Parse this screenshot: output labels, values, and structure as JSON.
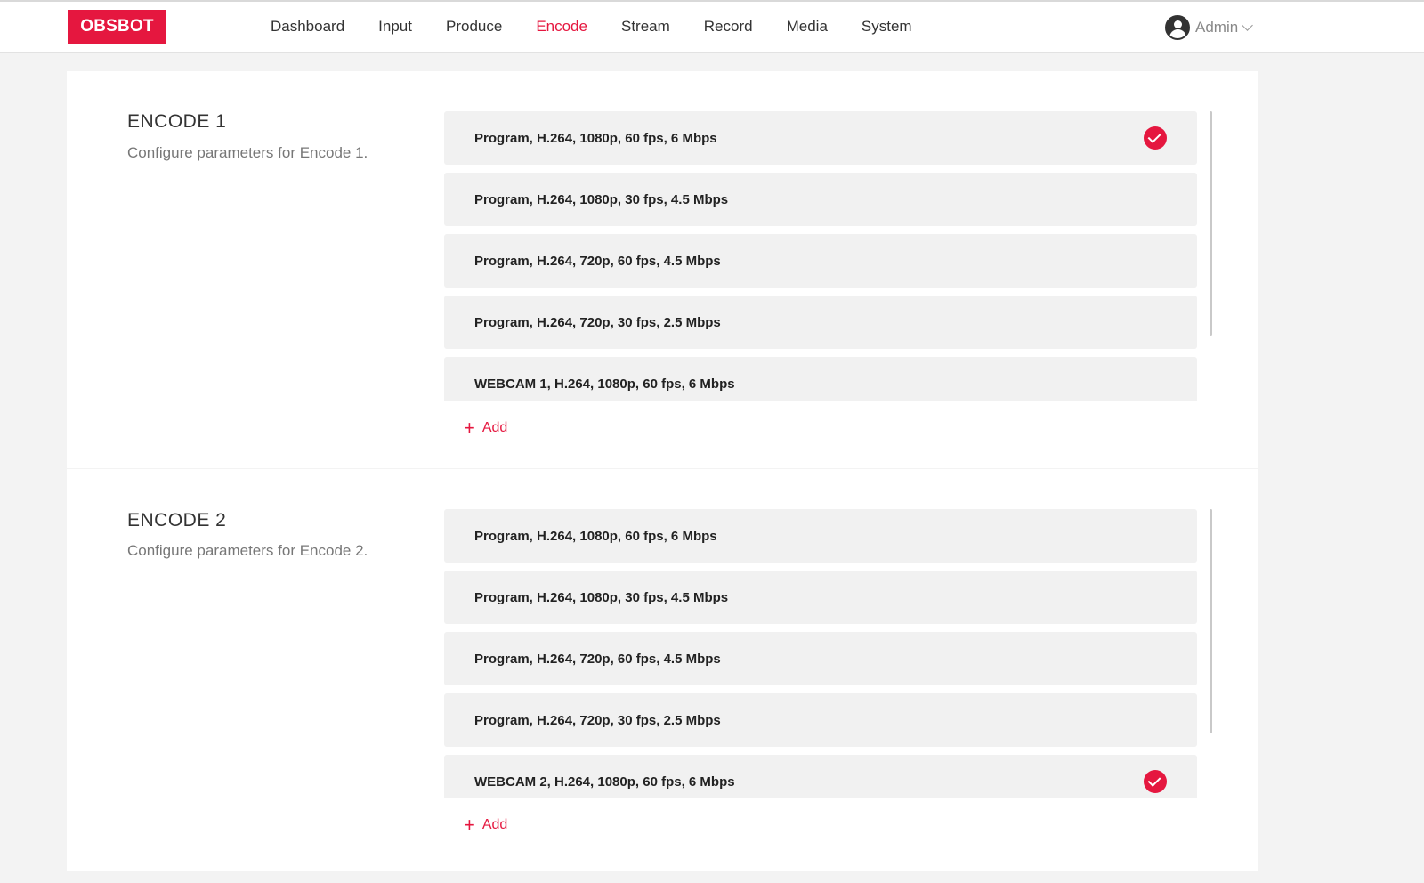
{
  "header": {
    "logo": "OBSBOT",
    "nav": [
      {
        "label": "Dashboard"
      },
      {
        "label": "Input"
      },
      {
        "label": "Produce"
      },
      {
        "label": "Encode"
      },
      {
        "label": "Stream"
      },
      {
        "label": "Record"
      },
      {
        "label": "Media"
      },
      {
        "label": "System"
      }
    ],
    "active_nav": "Encode",
    "user": "Admin"
  },
  "sections": [
    {
      "title": "ENCODE 1",
      "description": "Configure parameters for Encode 1.",
      "items": [
        {
          "label": "Program, H.264, 1080p, 60 fps, 6 Mbps",
          "selected": true
        },
        {
          "label": "Program, H.264, 1080p, 30 fps, 4.5 Mbps",
          "selected": false
        },
        {
          "label": "Program, H.264, 720p, 60 fps, 4.5 Mbps",
          "selected": false
        },
        {
          "label": "Program, H.264, 720p, 30 fps, 2.5 Mbps",
          "selected": false
        },
        {
          "label": "WEBCAM 1, H.264, 1080p, 60 fps, 6 Mbps",
          "selected": false
        }
      ],
      "add_label": "Add"
    },
    {
      "title": "ENCODE 2",
      "description": "Configure parameters for Encode 2.",
      "items": [
        {
          "label": "Program, H.264, 1080p, 60 fps, 6 Mbps",
          "selected": false
        },
        {
          "label": "Program, H.264, 1080p, 30 fps, 4.5 Mbps",
          "selected": false
        },
        {
          "label": "Program, H.264, 720p, 60 fps, 4.5 Mbps",
          "selected": false
        },
        {
          "label": "Program, H.264, 720p, 30 fps, 2.5 Mbps",
          "selected": false
        },
        {
          "label": "WEBCAM 2, H.264, 1080p, 60 fps, 6 Mbps",
          "selected": true
        }
      ],
      "add_label": "Add"
    }
  ],
  "colors": {
    "accent": "#e5173f"
  }
}
